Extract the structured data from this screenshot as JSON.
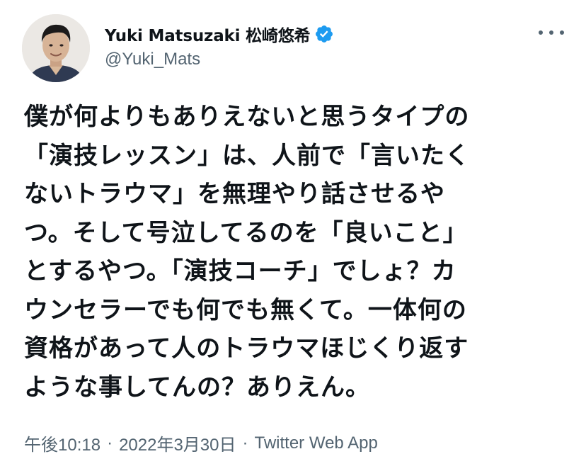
{
  "author": {
    "display_name": "Yuki Matsuzaki 松崎悠希",
    "handle": "@Yuki_Mats",
    "verified": true,
    "avatar_icon": "profile-photo-icon"
  },
  "more_icon": "more-options-icon",
  "tweet": {
    "lines": [
      "僕が何よりもありえないと思うタイプの",
      "「演技レッスン」は、人前で「言いたく",
      "ないトラウマ」を無理やり話させるや",
      "つ。そして号泣してるのを「良いこと」",
      "とするやつ。「演技コーチ」でしょ？カ",
      "ウンセラーでも何でも無くて。一体何の",
      "資格があって人のトラウマほじくり返す",
      "ような事してんの？ありえん。"
    ]
  },
  "meta": {
    "time": "午後10:18",
    "separator": "·",
    "date": "2022年3月30日",
    "source": "Twitter Web App"
  },
  "colors": {
    "text": "#0f1419",
    "secondary": "#536471",
    "verified": "#1d9bf0"
  }
}
